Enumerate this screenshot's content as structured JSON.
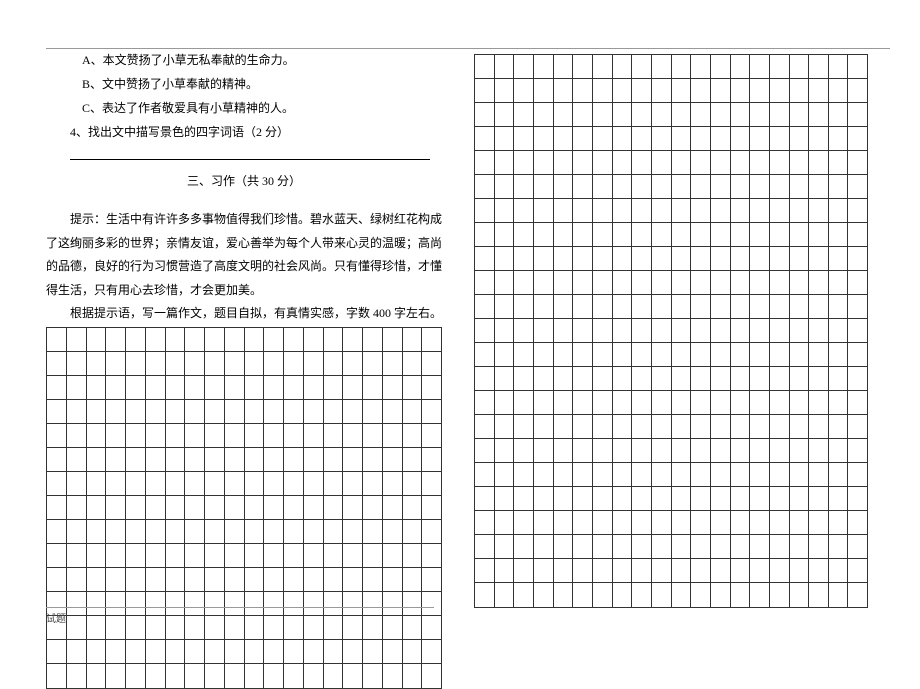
{
  "left": {
    "optionA": "A、本文赞扬了小草无私奉献的生命力。",
    "optionB": "B、文中赞扬了小草奉献的精神。",
    "optionC": "C、表达了作者敬爱具有小草精神的人。",
    "q4": "4、找出文中描写景色的四字词语（2 分）",
    "section_title": "三、习作（共 30 分）",
    "prompt1": "提示：生活中有许许多多事物值得我们珍惜。碧水蓝天、绿树红花构成了这绚丽多彩的世界；亲情友谊，爱心善举为每个人带来心灵的温暖；高尚的品德，良好的行为习惯营造了高度文明的社会风尚。只有懂得珍惜，才懂得生活，只有用心去珍惜，才会更加美。",
    "prompt2": "根据提示语，写一篇作文，题目自拟，有真情实感，字数 400 字左右。",
    "left_grid": {
      "cols": 20,
      "rows": 15
    }
  },
  "right": {
    "right_grid": {
      "cols": 20,
      "rows": 23
    }
  },
  "footer": "试题"
}
